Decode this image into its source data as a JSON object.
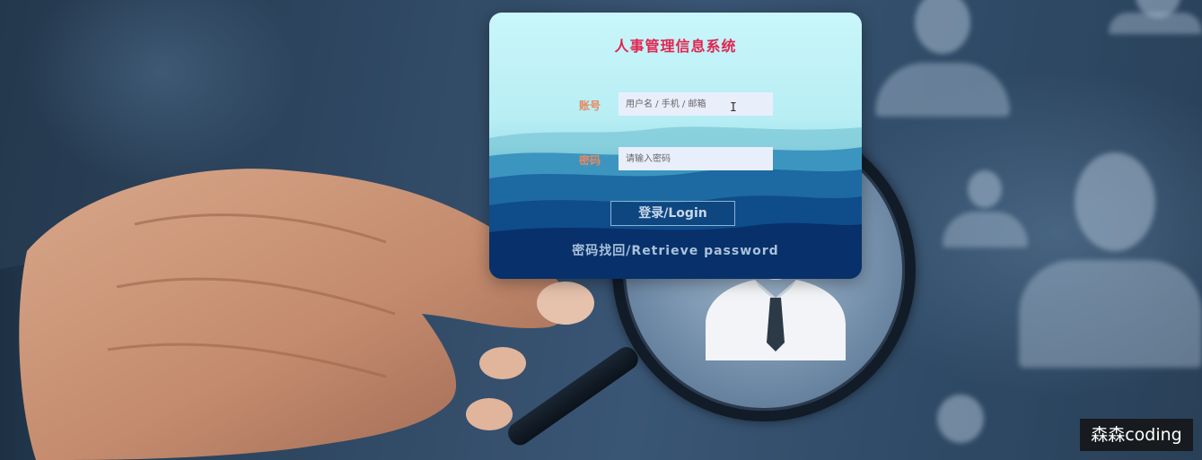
{
  "login": {
    "title": "人事管理信息系统",
    "account_label": "账号",
    "account_placeholder": "用户名 / 手机 / 邮箱",
    "password_label": "密码",
    "password_placeholder": "请输入密码",
    "login_button": "登录/Login",
    "retrieve_link": "密码找回/Retrieve password"
  },
  "watermark": {
    "text": "森森coding"
  },
  "colors": {
    "title": "#e2244f",
    "label": "#e7895f",
    "input_bg": "#e9eefb",
    "card_top": "#c9f6fa",
    "card_bottom": "#041c52"
  }
}
